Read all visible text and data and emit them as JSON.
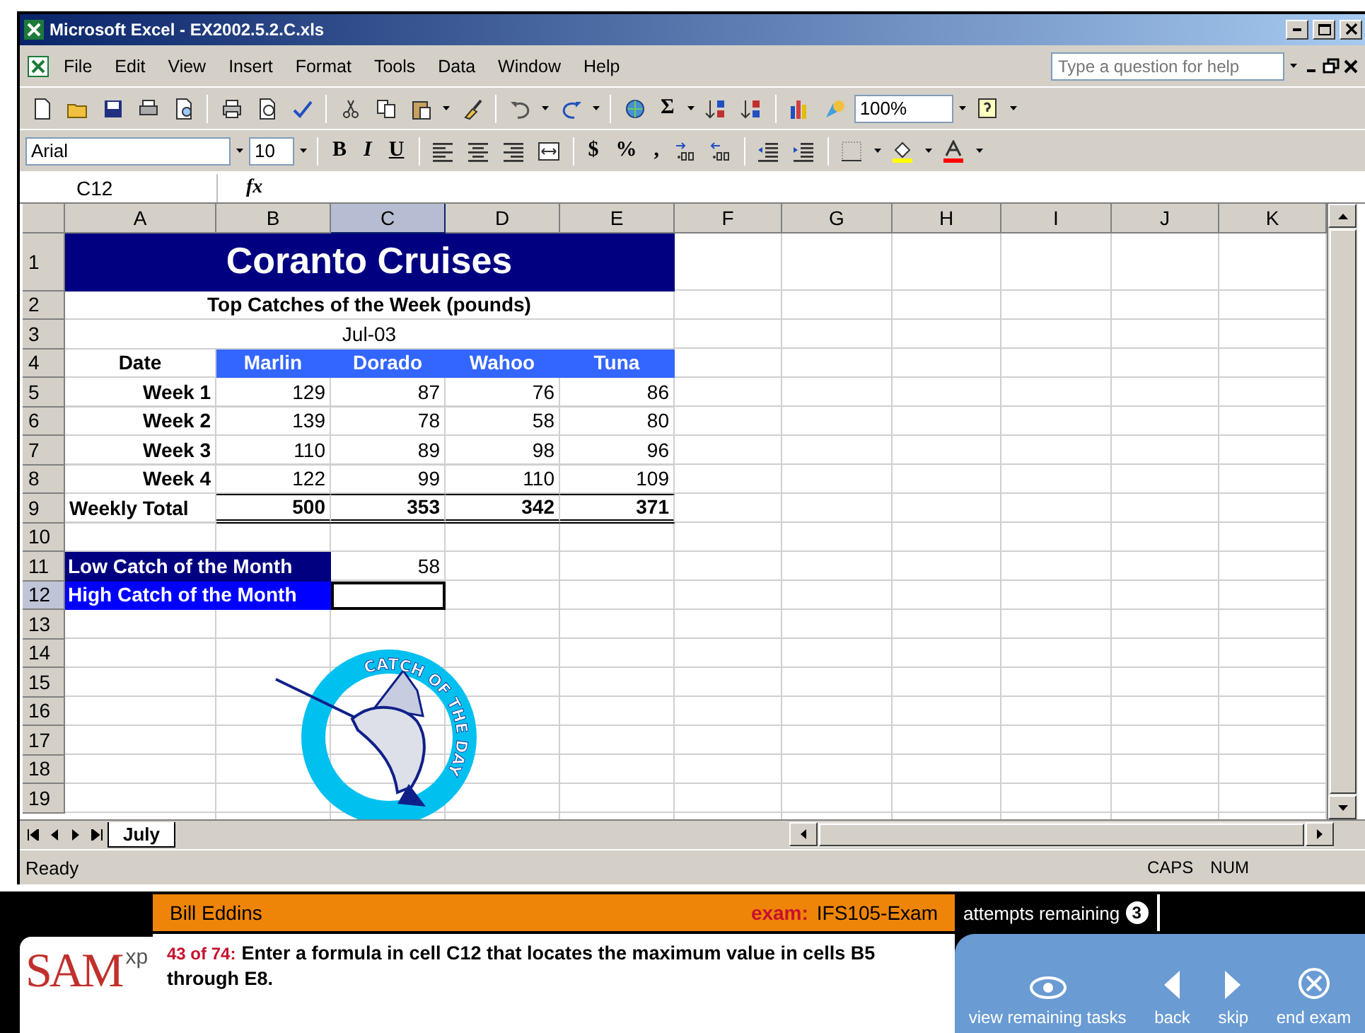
{
  "window": {
    "title": "Microsoft Excel - EX2002.5.2.C.xls"
  },
  "menu": [
    "File",
    "Edit",
    "View",
    "Insert",
    "Format",
    "Tools",
    "Data",
    "Window",
    "Help"
  ],
  "help_box": {
    "placeholder": "Type a question for help"
  },
  "standard_toolbar": {
    "autosum": "Σ",
    "zoom": "100%"
  },
  "formatting_toolbar": {
    "font": "Arial",
    "size": "10",
    "bold": "B",
    "italic": "I",
    "underline": "U",
    "currency": "$",
    "percent": "%",
    "comma": ","
  },
  "formula_bar": {
    "name_box": "C12",
    "fx": "fx"
  },
  "columns": [
    {
      "label": "A",
      "selected": false
    },
    {
      "label": "B",
      "selected": false
    },
    {
      "label": "C",
      "selected": true
    },
    {
      "label": "D",
      "selected": false
    },
    {
      "label": "E",
      "selected": false
    },
    {
      "label": "F",
      "selected": false
    },
    {
      "label": "G",
      "selected": false
    },
    {
      "label": "H",
      "selected": false
    },
    {
      "label": "I",
      "selected": false
    },
    {
      "label": "J",
      "selected": false
    },
    {
      "label": "K",
      "selected": false
    }
  ],
  "rows": [
    {
      "number": "1",
      "selected": false,
      "cells": [
        {
          "kind": "title",
          "text": "Coranto Cruises"
        }
      ]
    },
    {
      "number": "2",
      "selected": false,
      "cells": [
        {
          "kind": "subtitle",
          "text": "Top Catches of the Week (pounds)"
        }
      ]
    },
    {
      "number": "3",
      "selected": false,
      "cells": [
        {
          "kind": "date",
          "text": "Jul-03"
        }
      ]
    },
    {
      "number": "4",
      "selected": false,
      "cells": [
        {
          "kind": "label",
          "text": "Date"
        },
        {
          "kind": "header",
          "text": "Marlin"
        },
        {
          "kind": "header",
          "text": "Dorado"
        },
        {
          "kind": "header",
          "text": "Wahoo"
        },
        {
          "kind": "header",
          "text": "Tuna"
        }
      ]
    },
    {
      "number": "5",
      "selected": false,
      "cells": [
        {
          "kind": "week",
          "text": "Week 1"
        },
        {
          "kind": "number",
          "text": "129"
        },
        {
          "kind": "number",
          "text": "87"
        },
        {
          "kind": "number",
          "text": "76"
        },
        {
          "kind": "number",
          "text": "86"
        }
      ]
    },
    {
      "number": "6",
      "selected": false,
      "cells": [
        {
          "kind": "week",
          "text": "Week 2"
        },
        {
          "kind": "number",
          "text": "139"
        },
        {
          "kind": "number",
          "text": "78"
        },
        {
          "kind": "number",
          "text": "58"
        },
        {
          "kind": "number",
          "text": "80"
        }
      ]
    },
    {
      "number": "7",
      "selected": false,
      "cells": [
        {
          "kind": "week",
          "text": "Week 3"
        },
        {
          "kind": "number",
          "text": "110"
        },
        {
          "kind": "number",
          "text": "89"
        },
        {
          "kind": "number",
          "text": "98"
        },
        {
          "kind": "number",
          "text": "96"
        }
      ]
    },
    {
      "number": "8",
      "selected": false,
      "cells": [
        {
          "kind": "week",
          "text": "Week 4"
        },
        {
          "kind": "number",
          "text": "122"
        },
        {
          "kind": "number",
          "text": "99"
        },
        {
          "kind": "number",
          "text": "110"
        },
        {
          "kind": "number",
          "text": "109"
        }
      ]
    },
    {
      "number": "9",
      "selected": false,
      "cells": [
        {
          "kind": "total-label",
          "text": "Weekly Total"
        },
        {
          "kind": "total",
          "text": "500"
        },
        {
          "kind": "total",
          "text": "353"
        },
        {
          "kind": "total",
          "text": "342"
        },
        {
          "kind": "total",
          "text": "371"
        }
      ]
    },
    {
      "number": "10",
      "selected": false
    },
    {
      "number": "11",
      "selected": false,
      "cells": [
        {
          "kind": "band",
          "text": "Low Catch of the Month",
          "color": "#000080"
        },
        {
          "kind": "number",
          "text": "58"
        }
      ]
    },
    {
      "number": "12",
      "selected": true,
      "cells": [
        {
          "kind": "band",
          "text": "High Catch of the Month",
          "color": "#0000ff"
        }
      ]
    },
    {
      "number": "13",
      "selected": false
    },
    {
      "number": "14",
      "selected": false
    },
    {
      "number": "15",
      "selected": false
    },
    {
      "number": "16",
      "selected": false
    },
    {
      "number": "17",
      "selected": false
    },
    {
      "number": "18",
      "selected": false
    },
    {
      "number": "19",
      "selected": false
    }
  ],
  "clipart": {
    "caption": "CATCH OF THE DAY"
  },
  "sheet_tabs": [
    {
      "label": "July",
      "selected": true
    }
  ],
  "status_bar": {
    "text": "Ready",
    "indicators": [
      "CAPS",
      "NUM"
    ]
  },
  "exam": {
    "user": "Bill Eddins",
    "exam_label": "exam:",
    "exam_name": "IFS105-Exam",
    "attempts_label": "attempts remaining",
    "attempts": "3",
    "logo": {
      "text": "SAM",
      "suffix": "xp"
    },
    "question_number": "43 of 74:",
    "question": "Enter a formula in cell C12 that locates the maximum value in cells B5 through E8.",
    "buttons": [
      {
        "kind": "view",
        "label": "view remaining tasks"
      },
      {
        "kind": "back",
        "label": "back"
      },
      {
        "kind": "skip",
        "label": "skip"
      },
      {
        "kind": "end",
        "label": "end exam"
      }
    ]
  }
}
